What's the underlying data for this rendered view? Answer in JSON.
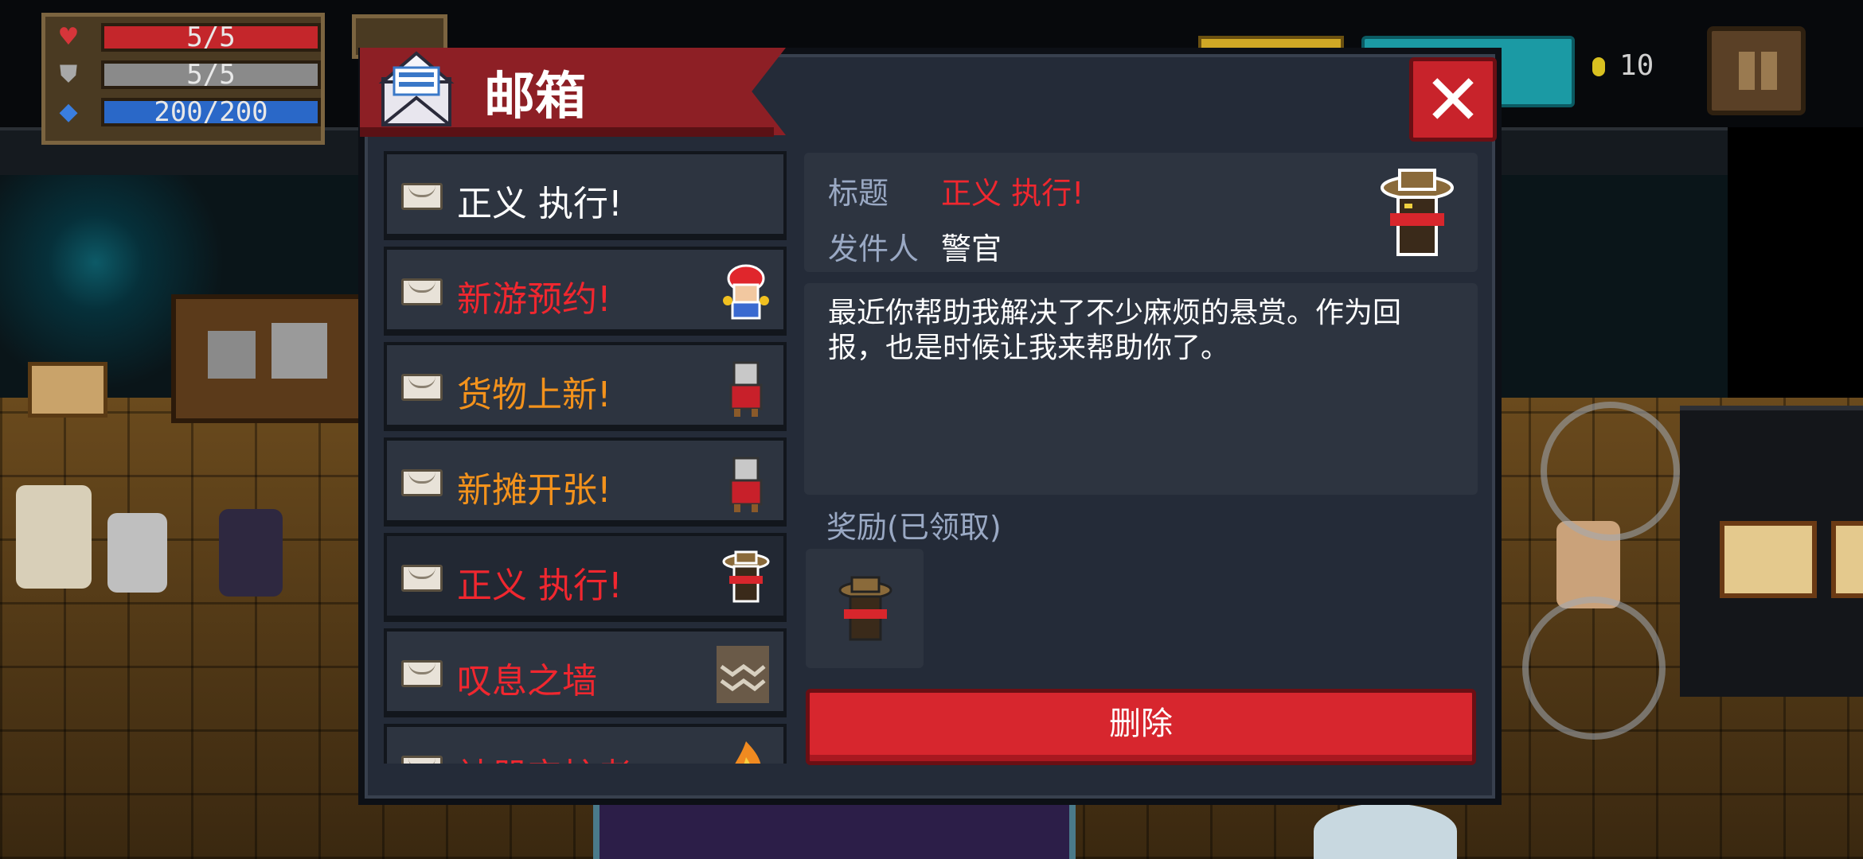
{
  "hud": {
    "health": "5/5",
    "armor": "5/5",
    "energy": "200/200",
    "coins": "10"
  },
  "mailbox": {
    "title": "邮箱",
    "mails": [
      {
        "title": "正义 执行!",
        "color": "#ffffff",
        "thumb": "sheriff-icon",
        "selected": false
      },
      {
        "title": "新游预约!",
        "color": "#f0272f",
        "thumb": "red-hat-kid-icon",
        "selected": false
      },
      {
        "title": "货物上新!",
        "color": "#f3921c",
        "thumb": "merchant-icon",
        "selected": false
      },
      {
        "title": "新摊开张!",
        "color": "#f3921c",
        "thumb": "merchant-icon",
        "selected": false
      },
      {
        "title": "正义 执行!",
        "color": "#f0272f",
        "thumb": "sheriff-icon",
        "selected": true
      },
      {
        "title": "叹息之墙",
        "color": "#f0272f",
        "thumb": "wall-icon",
        "selected": false
      },
      {
        "title": "神器守护者",
        "color": "#f0272f",
        "thumb": "fire-icon",
        "selected": false
      }
    ],
    "detail": {
      "title_label": "标题",
      "title_value": "正义 执行!",
      "sender_label": "发件人",
      "sender_value": "警官",
      "body": "最近你帮助我解决了不少麻烦的悬赏。作为回报，也是时候让我来帮助你了。",
      "reward_label": "奖励(已领取)",
      "delete_label": "删除"
    }
  }
}
